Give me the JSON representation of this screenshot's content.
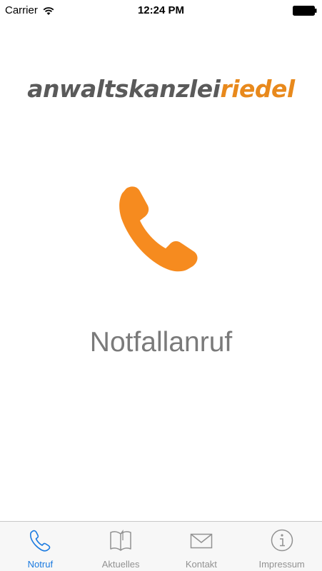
{
  "status_bar": {
    "carrier": "Carrier",
    "time": "12:24 PM"
  },
  "logo": {
    "part1": "anwaltskanzlei",
    "part2": "riedel"
  },
  "call": {
    "label": "Notfallanruf"
  },
  "colors": {
    "accent": "#f68b1f",
    "active_tab": "#1a7ae0",
    "inactive_tab": "#929292",
    "logo_gray": "#5a5a5a",
    "logo_orange": "#e8891c"
  },
  "tab_bar": {
    "tabs": [
      {
        "label": "Notruf",
        "icon": "phone-icon",
        "active": true
      },
      {
        "label": "Aktuelles",
        "icon": "book-icon",
        "active": false
      },
      {
        "label": "Kontakt",
        "icon": "envelope-icon",
        "active": false
      },
      {
        "label": "Impressum",
        "icon": "info-icon",
        "active": false
      }
    ]
  }
}
